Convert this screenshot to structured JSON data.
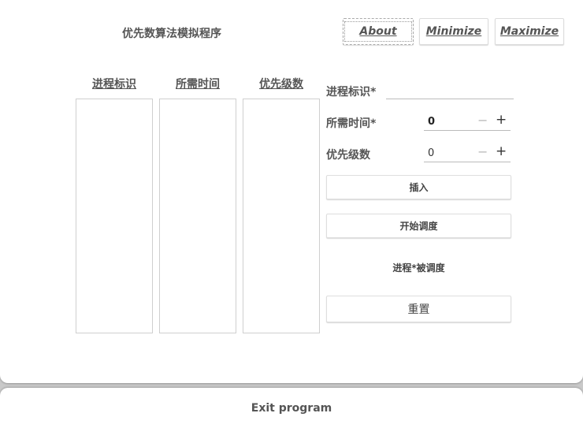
{
  "window": {
    "title": "优先数算法模拟程序"
  },
  "header_buttons": {
    "about": "About",
    "minimize": "Minimize",
    "maximize": "Maximize"
  },
  "table": {
    "columns": [
      "进程标识",
      "所需时间",
      "优先级数"
    ]
  },
  "form": {
    "process_id_label": "进程标识*",
    "process_id_value": "",
    "time_label": "所需时间*",
    "time_value": "0",
    "priority_label": "优先级数",
    "priority_value": "0"
  },
  "actions": {
    "insert": "插入",
    "start": "开始调度",
    "reset": "重置"
  },
  "status": {
    "text": "进程*被调度"
  },
  "footer": {
    "exit": "Exit program"
  }
}
